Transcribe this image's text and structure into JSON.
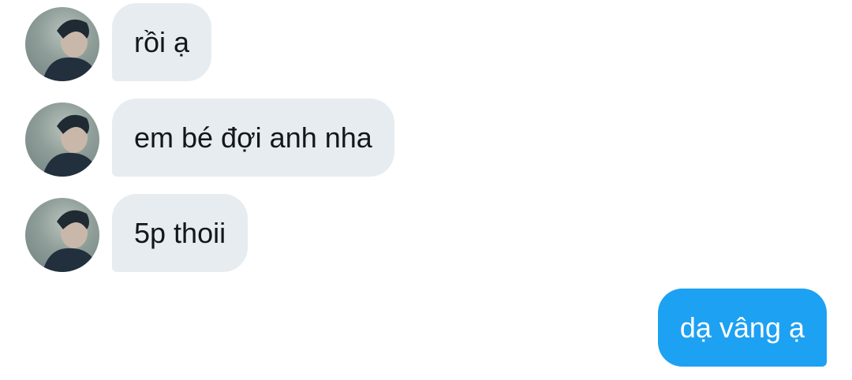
{
  "messages": [
    {
      "direction": "incoming",
      "text": "rồi ạ",
      "avatar": "user-avatar"
    },
    {
      "direction": "incoming",
      "text": "em bé đợi anh nha",
      "avatar": "user-avatar"
    },
    {
      "direction": "incoming",
      "text": "5p thoii",
      "avatar": "user-avatar"
    },
    {
      "direction": "outgoing",
      "text": "dạ vâng ạ"
    }
  ],
  "colors": {
    "incoming_bubble": "#e6ecf0",
    "outgoing_bubble": "#1da1f2",
    "incoming_text": "#14171a",
    "outgoing_text": "#ffffff"
  }
}
